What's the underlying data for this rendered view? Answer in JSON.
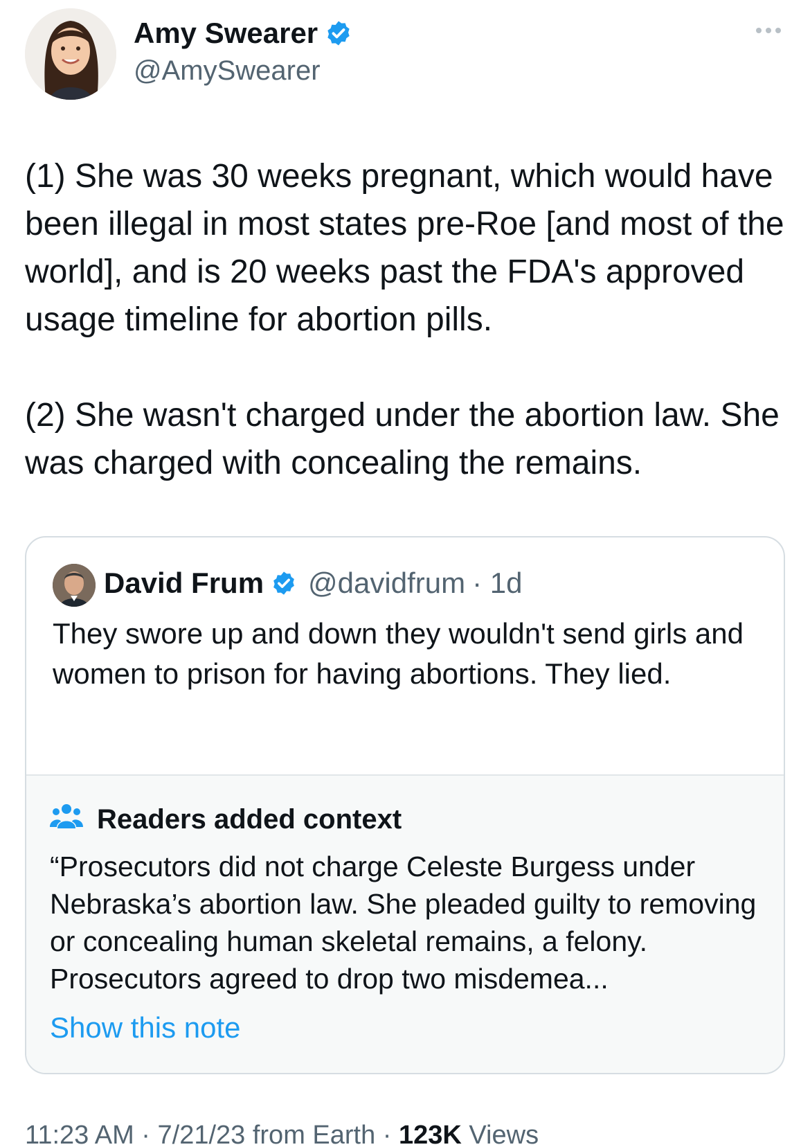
{
  "author": {
    "name": "Amy Swearer",
    "handle": "@AmySwearer",
    "verified_color": "#1d9bf0"
  },
  "tweet": {
    "paragraphs": [
      "(1) She was 30 weeks pregnant, which would have been illegal in most states pre-Roe [and most of the world], and is 20 weeks past the FDA's approved usage timeline for abortion pills.",
      "(2) She wasn't charged under the abortion law. She was charged with concealing the remains."
    ]
  },
  "quoted_tweet": {
    "name": "David Frum",
    "handle": "@davidfrum",
    "time": "· 1d",
    "text": "They swore up and down they wouldn't send girls and women to prison for having abortions. They lied."
  },
  "community_note": {
    "title": "Readers added context",
    "text": "“Prosecutors did not charge Celeste Burgess under Nebraska’s abortion law. She pleaded guilty to removing or concealing human skeletal remains, a felony. Prosecutors agreed to drop two misdemea...",
    "link_label": "Show this note",
    "icon": "people-icon"
  },
  "meta": {
    "time_date": "11:23 AM · 7/21/23 from Earth · ",
    "views_count": "123K",
    "views_label": " Views"
  },
  "colors": {
    "text": "#0f1419",
    "secondary": "#536471",
    "accent": "#1d9bf0",
    "note_bg": "#f7f9f9"
  }
}
